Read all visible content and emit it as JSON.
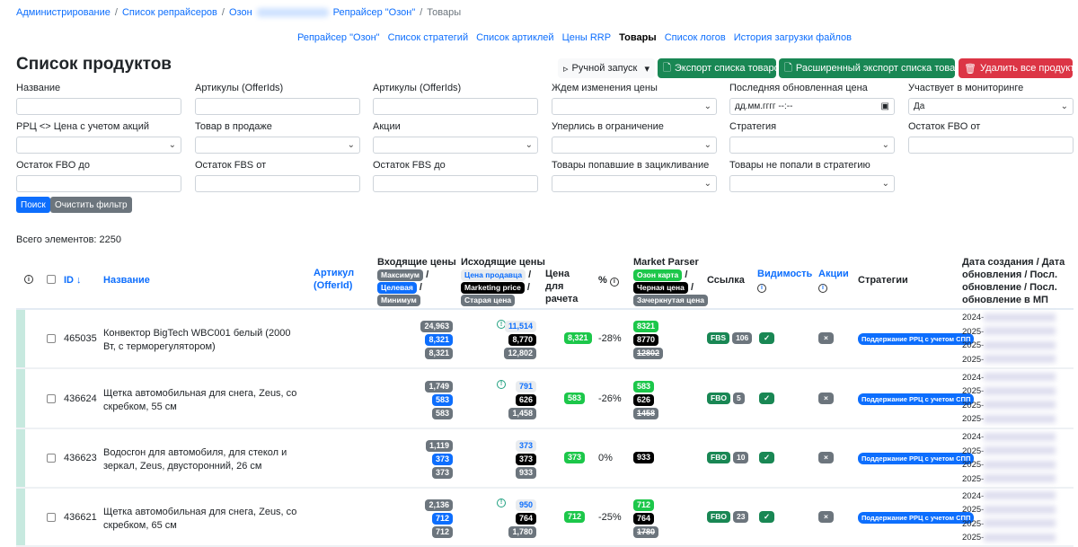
{
  "breadcrumb": [
    "Администрирование",
    "Список репрайсеров",
    "Озон",
    "Репрайсер \"Озон\"",
    "Товары"
  ],
  "nav": [
    "Репрайсер \"Озон\"",
    "Список стратегий",
    "Список артиклей",
    "Цены RRP",
    "Товары",
    "Список логов",
    "История загрузки файлов"
  ],
  "title": "Список продуктов",
  "actions": {
    "manual": "Ручной запуск",
    "export": "Экспорт списка товаров",
    "ext_export": "Расширенный экспорт списка товаров",
    "delete": "Удалить все продукты"
  },
  "filters": [
    {
      "label": "Название",
      "value": "",
      "type": "text"
    },
    {
      "label": "Артикулы (OfferIds)",
      "value": "",
      "type": "text"
    },
    {
      "label": "Артикулы (OfferIds)",
      "value": "",
      "type": "text"
    },
    {
      "label": "Ждем изменения цены",
      "value": "",
      "type": "select"
    },
    {
      "label": "Последняя обновленная цена",
      "value": "дд.мм.гггг --:--",
      "type": "date"
    },
    {
      "label": "Участвует в мониторинге",
      "value": "Да",
      "type": "select"
    },
    {
      "label": "РРЦ <> Цена с учетом акций",
      "value": "",
      "type": "select"
    },
    {
      "label": "Товар в продаже",
      "value": "",
      "type": "select"
    },
    {
      "label": "Акции",
      "value": "",
      "type": "select"
    },
    {
      "label": "Уперлись в ограничение",
      "value": "",
      "type": "select"
    },
    {
      "label": "Стратегия",
      "value": "",
      "type": "select"
    },
    {
      "label": "Остаток FBO от",
      "value": "",
      "type": "text"
    },
    {
      "label": "Остаток FBO до",
      "value": "",
      "type": "text"
    },
    {
      "label": "Остаток FBS от",
      "value": "",
      "type": "text"
    },
    {
      "label": "Остаток FBS до",
      "value": "",
      "type": "text"
    },
    {
      "label": "Товары попавшие в зацикливание",
      "value": "",
      "type": "select"
    },
    {
      "label": "Товары не попали в стратегию",
      "value": "",
      "type": "select"
    }
  ],
  "search_btn": "Поиск",
  "clear_btn": "Очистить фильтр",
  "total": "Всего элементов: 2250",
  "headers": {
    "id": "ID ↓",
    "name": "Название",
    "article": "Артикул (OfferId)",
    "incoming": "Входящие цены",
    "in_max": "Максимум",
    "in_target": "Целевая",
    "in_min": "Минимум",
    "outgoing": "Исходящие цены",
    "out_seller": "Цена продавца",
    "out_marketing": "Marketing price",
    "out_old": "Старая цена",
    "calc": "Цена для рачета",
    "pct": "%",
    "mp": "Market Parser",
    "mp_ozon": "Озон карта",
    "mp_black": "Черная цена",
    "mp_crossed": "Зачеркнутая цена",
    "link": "Ссылка",
    "visibility": "Видимость",
    "promos": "Акции",
    "strategies": "Стратегии",
    "dates": "Дата создания / Дата обновления / Посл. обновление / Посл. обновление в МП"
  },
  "rows": [
    {
      "id": "465035",
      "name": "Конвектор BigTech WBC001 белый (2000 Вт, с терморегулятором)",
      "in": [
        "24,963",
        "8,321",
        "8,321"
      ],
      "warn": true,
      "out": [
        "11,514",
        "8,770",
        "12,802"
      ],
      "calc": "8,321",
      "pct": "-28%",
      "mp": [
        "8321",
        "8770",
        "12802"
      ],
      "link": "FBS",
      "stock": "106",
      "strategy": "Поддержание РРЦ с учетом СПП",
      "dates": [
        "2024-",
        "2025-",
        "2025-",
        "2025-"
      ]
    },
    {
      "id": "436624",
      "name": "Щетка автомобильная для снега, Zeus, со скребком, 55 см",
      "in": [
        "1,749",
        "583",
        "583"
      ],
      "warn": true,
      "out": [
        "791",
        "626",
        "1,458"
      ],
      "calc": "583",
      "pct": "-26%",
      "mp": [
        "583",
        "626",
        "1458"
      ],
      "link": "FBO",
      "stock": "5",
      "strategy": "Поддержание РРЦ с учетом СПП",
      "dates": [
        "2024-",
        "2025-",
        "2025-",
        "2025-"
      ]
    },
    {
      "id": "436623",
      "name": "Водосгон для автомобиля, для стекол и зеркал, Zeus, двусторонний, 26 см",
      "in": [
        "1,119",
        "373",
        "373"
      ],
      "warn": false,
      "out": [
        "373",
        "373",
        "933"
      ],
      "calc": "373",
      "pct": "0%",
      "mp": [
        "",
        "933",
        ""
      ],
      "link": "FBO",
      "stock": "10",
      "strategy": "Поддержание РРЦ с учетом СПП",
      "dates": [
        "2024-",
        "2025-",
        "2025-",
        "2025-"
      ]
    },
    {
      "id": "436621",
      "name": "Щетка автомобильная для снега, Zeus, со скребком, 65 см",
      "in": [
        "2,136",
        "712",
        "712"
      ],
      "warn": true,
      "out": [
        "950",
        "764",
        "1,780"
      ],
      "calc": "712",
      "pct": "-25%",
      "mp": [
        "712",
        "764",
        "1780"
      ],
      "link": "FBO",
      "stock": "23",
      "strategy": "Поддержание РРЦ с учетом СПП",
      "dates": [
        "2024-",
        "2025-",
        "2025-",
        "2025-"
      ]
    }
  ]
}
